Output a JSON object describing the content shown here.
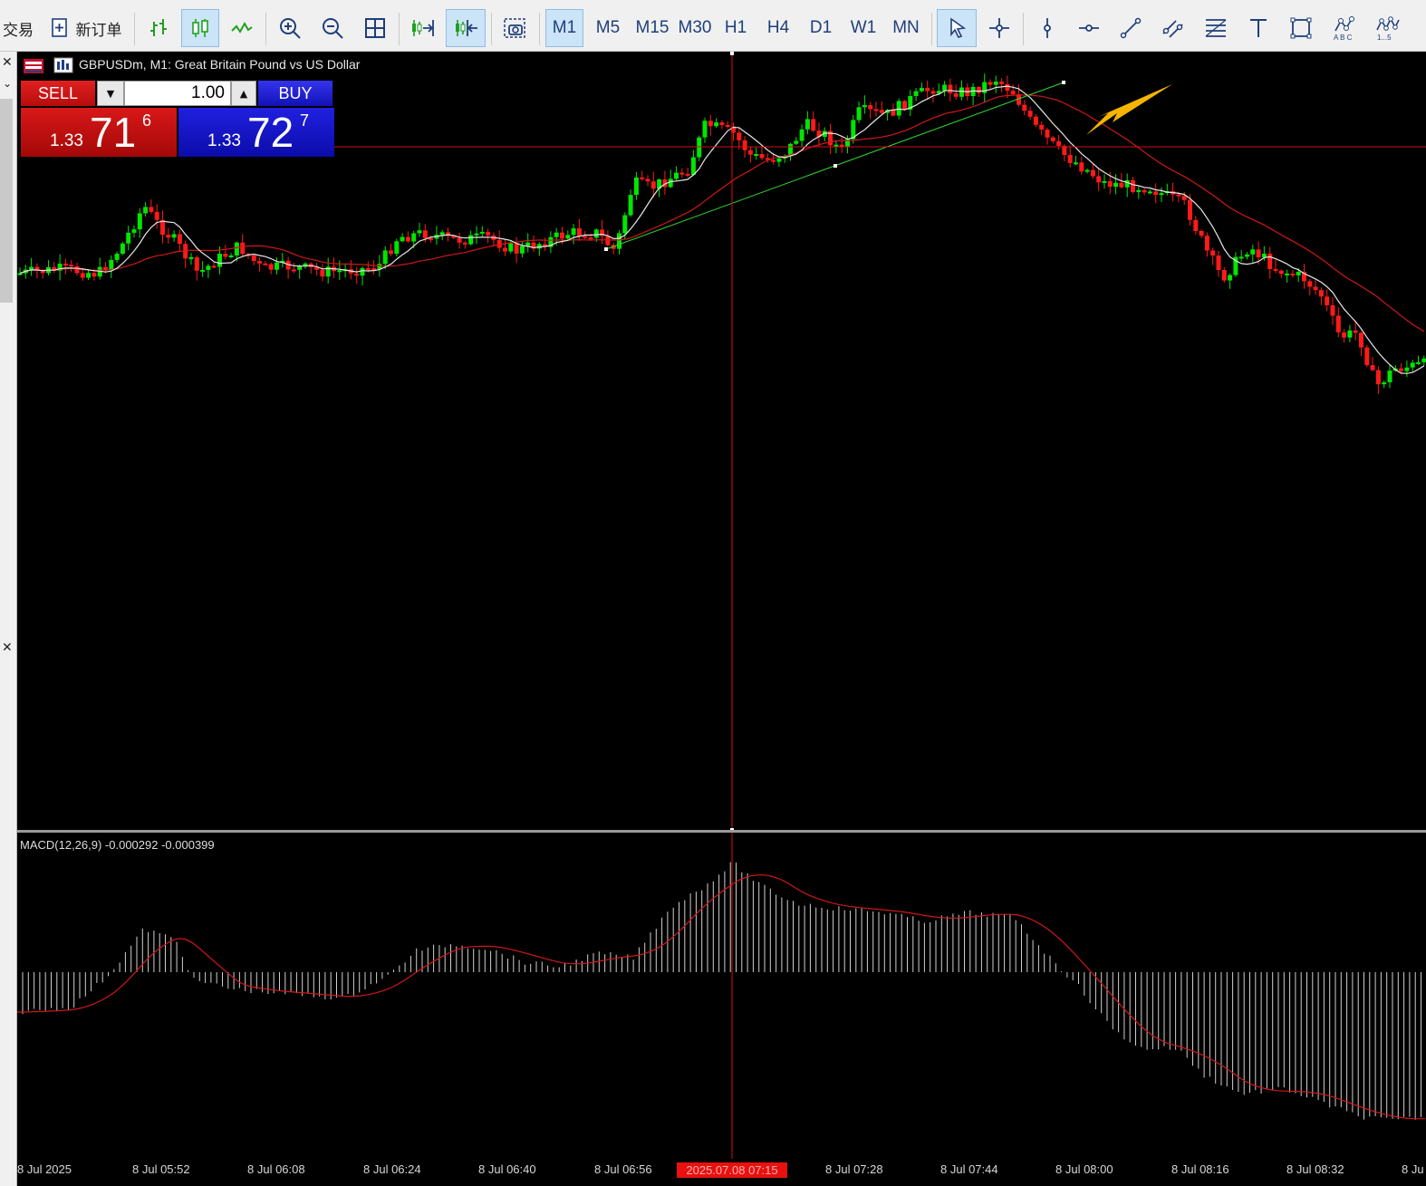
{
  "toolbar": {
    "trade_label": "交易",
    "new_order_label": "新订单",
    "timeframes": [
      "M1",
      "M5",
      "M15",
      "M30",
      "H1",
      "H4",
      "D1",
      "W1",
      "MN"
    ],
    "active_timeframe": "M1"
  },
  "chart": {
    "title": "GBPUSDm, M1:  Great Britain Pound vs US Dollar",
    "background": "#000000",
    "bull_color": "#00e600",
    "bear_color": "#ff1a1a",
    "crosshair_color": "#d01010",
    "trendline_color": "#2fd82f",
    "arrow_color": "#f5b400"
  },
  "one_click": {
    "sell_label": "SELL",
    "buy_label": "BUY",
    "volume": "1.00",
    "sell_price_prefix": "1.33",
    "sell_price_main": "71",
    "sell_price_super": "6",
    "buy_price_prefix": "1.33",
    "buy_price_main": "72",
    "buy_price_super": "7"
  },
  "macd": {
    "label": "MACD(12,26,9) -0.000292 -0.000399"
  },
  "time_axis": {
    "ticks": [
      "8 Jul 2025",
      "8 Jul 05:52",
      "8 Jul 06:08",
      "8 Jul 06:24",
      "8 Jul 06:40",
      "8 Jul 06:56",
      "8 Jul 07:28",
      "8 Jul 07:44",
      "8 Jul 08:00",
      "8 Jul 08:16",
      "8 Jul 08:32",
      "8 Ju"
    ],
    "crosshair_label": "2025.07.08 07:15"
  }
}
